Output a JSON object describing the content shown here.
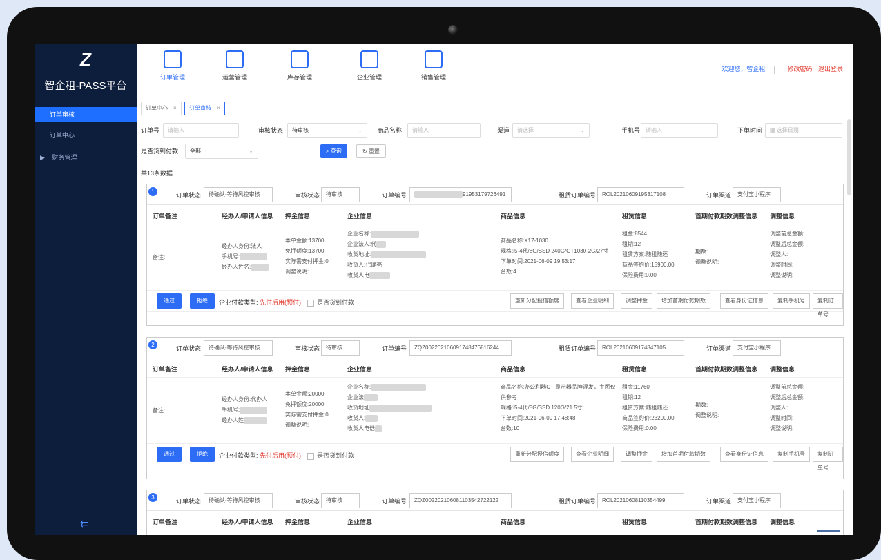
{
  "sidebar": {
    "logo": "Z",
    "brand": "智企租-PASS平台",
    "items": [
      {
        "label": "订单审核",
        "active": true
      },
      {
        "label": "订单中心",
        "active": false
      },
      {
        "label": "财务管理",
        "active": false
      }
    ],
    "group_arrow": "▶",
    "collapse_icon": "⇇"
  },
  "topnav": {
    "items": [
      {
        "label": "订单管理",
        "icon": "clipboard-icon",
        "active": true
      },
      {
        "label": "运营管理",
        "icon": "grid-icon",
        "active": false
      },
      {
        "label": "库存管理",
        "icon": "cubes-icon",
        "active": false
      },
      {
        "label": "企业管理",
        "icon": "building-icon",
        "active": false
      },
      {
        "label": "销售管理",
        "icon": "hand-icon",
        "active": false
      }
    ],
    "welcome": "欢迎您，智企租",
    "change_password": "修改密码",
    "logout": "退出登录"
  },
  "tabs": [
    {
      "label": "订单中心",
      "close": "×"
    },
    {
      "label": "订单审核",
      "close": "×"
    }
  ],
  "filters": {
    "order_no_label": "订单号",
    "order_no_ph": "请输入",
    "audit_label": "审核状态",
    "audit_value": "待审核",
    "product_label": "商品名称",
    "product_ph": "请输入",
    "channel_label": "渠道",
    "channel_ph": "请选择",
    "phone_label": "手机号",
    "phone_ph": "请输入",
    "time_label": "下单时间",
    "time_ph": "选择日期",
    "arrival_label": "是否货到付款",
    "arrival_value": "全部",
    "query": "查询",
    "reset": "重置"
  },
  "count_text": "共13条数据",
  "labels": {
    "order_status": "订单状态",
    "audit_status": "审核状态",
    "order_no": "订单编号",
    "lease_no": "租赁订单编号",
    "channel": "订单渠道",
    "col_remark": "订单备注",
    "col_handler": "经办人/申请人信息",
    "col_deposit": "押金信息",
    "col_company": "企业信息",
    "col_goods": "商品信息",
    "col_lease": "租赁信息",
    "col_first": "首期付款期数调整信息",
    "col_adjust": "调整信息",
    "remark": "备注:",
    "pass": "通过",
    "reject": "拒绝",
    "pay_type": "企业付款类型:",
    "pay_value": "先付后用(预付)",
    "cod": "是否货到付款",
    "ops": [
      "重新分配授信额度",
      "查看企业明细",
      "调整押金",
      "增加首期付款期数",
      "查看身份证信息",
      "复制手机号",
      "复制订单号"
    ]
  },
  "orders": [
    {
      "index": "1",
      "status": "待确认-等待风控审核",
      "audit": "待审核",
      "order_no": "91953179726491",
      "lease_no": "ROL20210609195317108",
      "channel": "支付宝小程序",
      "handler": [
        "经办人身份:法人",
        "手机号:",
        "经办人姓名:"
      ],
      "deposit": [
        "本单金额:13700",
        "免押额度:13700",
        "实际需支付押金:0",
        "调整说明:"
      ],
      "company": [
        "企业名称:",
        "企业法人:代",
        "收货地址:",
        "收货人:代璐亮",
        "收货人电"
      ],
      "goods": [
        "商品名称:X17-1030",
        "规格:i5-4代/8G/SSD 240G/GT1030-2G/27寸",
        "下单时间:2021-06-09 19:53:17",
        "台数:4"
      ],
      "lease": [
        "租金:8544",
        "租期:12",
        "租赁方案:随租随还",
        "商品签约价:15900.00",
        "保险费用:0.00"
      ],
      "first": [
        "期数:",
        "调整说明:"
      ],
      "adjust": [
        "调整前总金额:",
        "调整后总金额:",
        "调整人:",
        "调整时间:",
        "调整说明:"
      ]
    },
    {
      "index": "2",
      "status": "待确认-等待风控审核",
      "audit": "待审核",
      "order_no": "ZQZ002202106091748476816244",
      "lease_no": "ROL20210609174847105",
      "channel": "支付宝小程序",
      "handler": [
        "经办人身份:代办人",
        "手机号:",
        "经办人姓"
      ],
      "deposit": [
        "本单金额:20000",
        "免押额度:20000",
        "实际需支付押金:0",
        "调整说明:"
      ],
      "company": [
        "企业名称:",
        "企业法",
        "收货地址",
        "收货人:",
        "收货人电话"
      ],
      "goods": [
        "商品名称:办公利器C+ 显示器品牌混发，主图仅",
        "供参考",
        "规格:i5-4代/8G/SSD 120G/21.5寸",
        "下单时间:2021-06-09 17:48:48",
        "台数:10"
      ],
      "lease": [
        "租金:11760",
        "租期:12",
        "租赁方案:随租随还",
        "商品签约价:23200.00",
        "保险费用:0.00"
      ],
      "first": [
        "期数:",
        "调整说明:"
      ],
      "adjust": [
        "调整前总金额:",
        "调整后总金额:",
        "调整人:",
        "调整时间:",
        "调整说明:"
      ]
    },
    {
      "index": "3",
      "status": "待确认-等待风控审核",
      "audit": "待审核",
      "order_no": "ZQZ002202106081103542722122",
      "lease_no": "ROL20210608110354499",
      "channel": "支付宝小程序"
    }
  ]
}
